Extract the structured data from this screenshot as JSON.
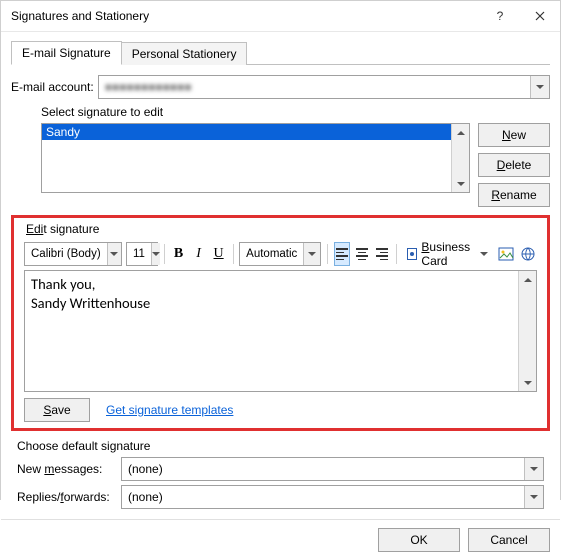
{
  "titlebar": {
    "title": "Signatures and Stationery"
  },
  "tabs": {
    "email": "E-mail Signature",
    "stationery": "Personal Stationery"
  },
  "email_account": {
    "label": "E-mail account:",
    "value": "■■■■■■■■■■■■"
  },
  "select_label": "Select signature to edit",
  "signatures": [
    "Sandy"
  ],
  "side_buttons": {
    "new": "New",
    "delete": "Delete",
    "rename": "Rename"
  },
  "edit": {
    "title": "Edit signature",
    "font": "Calibri (Body)",
    "size": "11",
    "color": "Automatic",
    "bizcard": "Business Card",
    "content": "Thank you,\nSandy Writtenhouse",
    "save": "Save",
    "templates": "Get signature templates"
  },
  "defaults": {
    "title": "Choose default signature",
    "new_label": "New messages:",
    "new_value": "(none)",
    "reply_label": "Replies/forwards:",
    "reply_value": "(none)"
  },
  "footer": {
    "ok": "OK",
    "cancel": "Cancel"
  }
}
